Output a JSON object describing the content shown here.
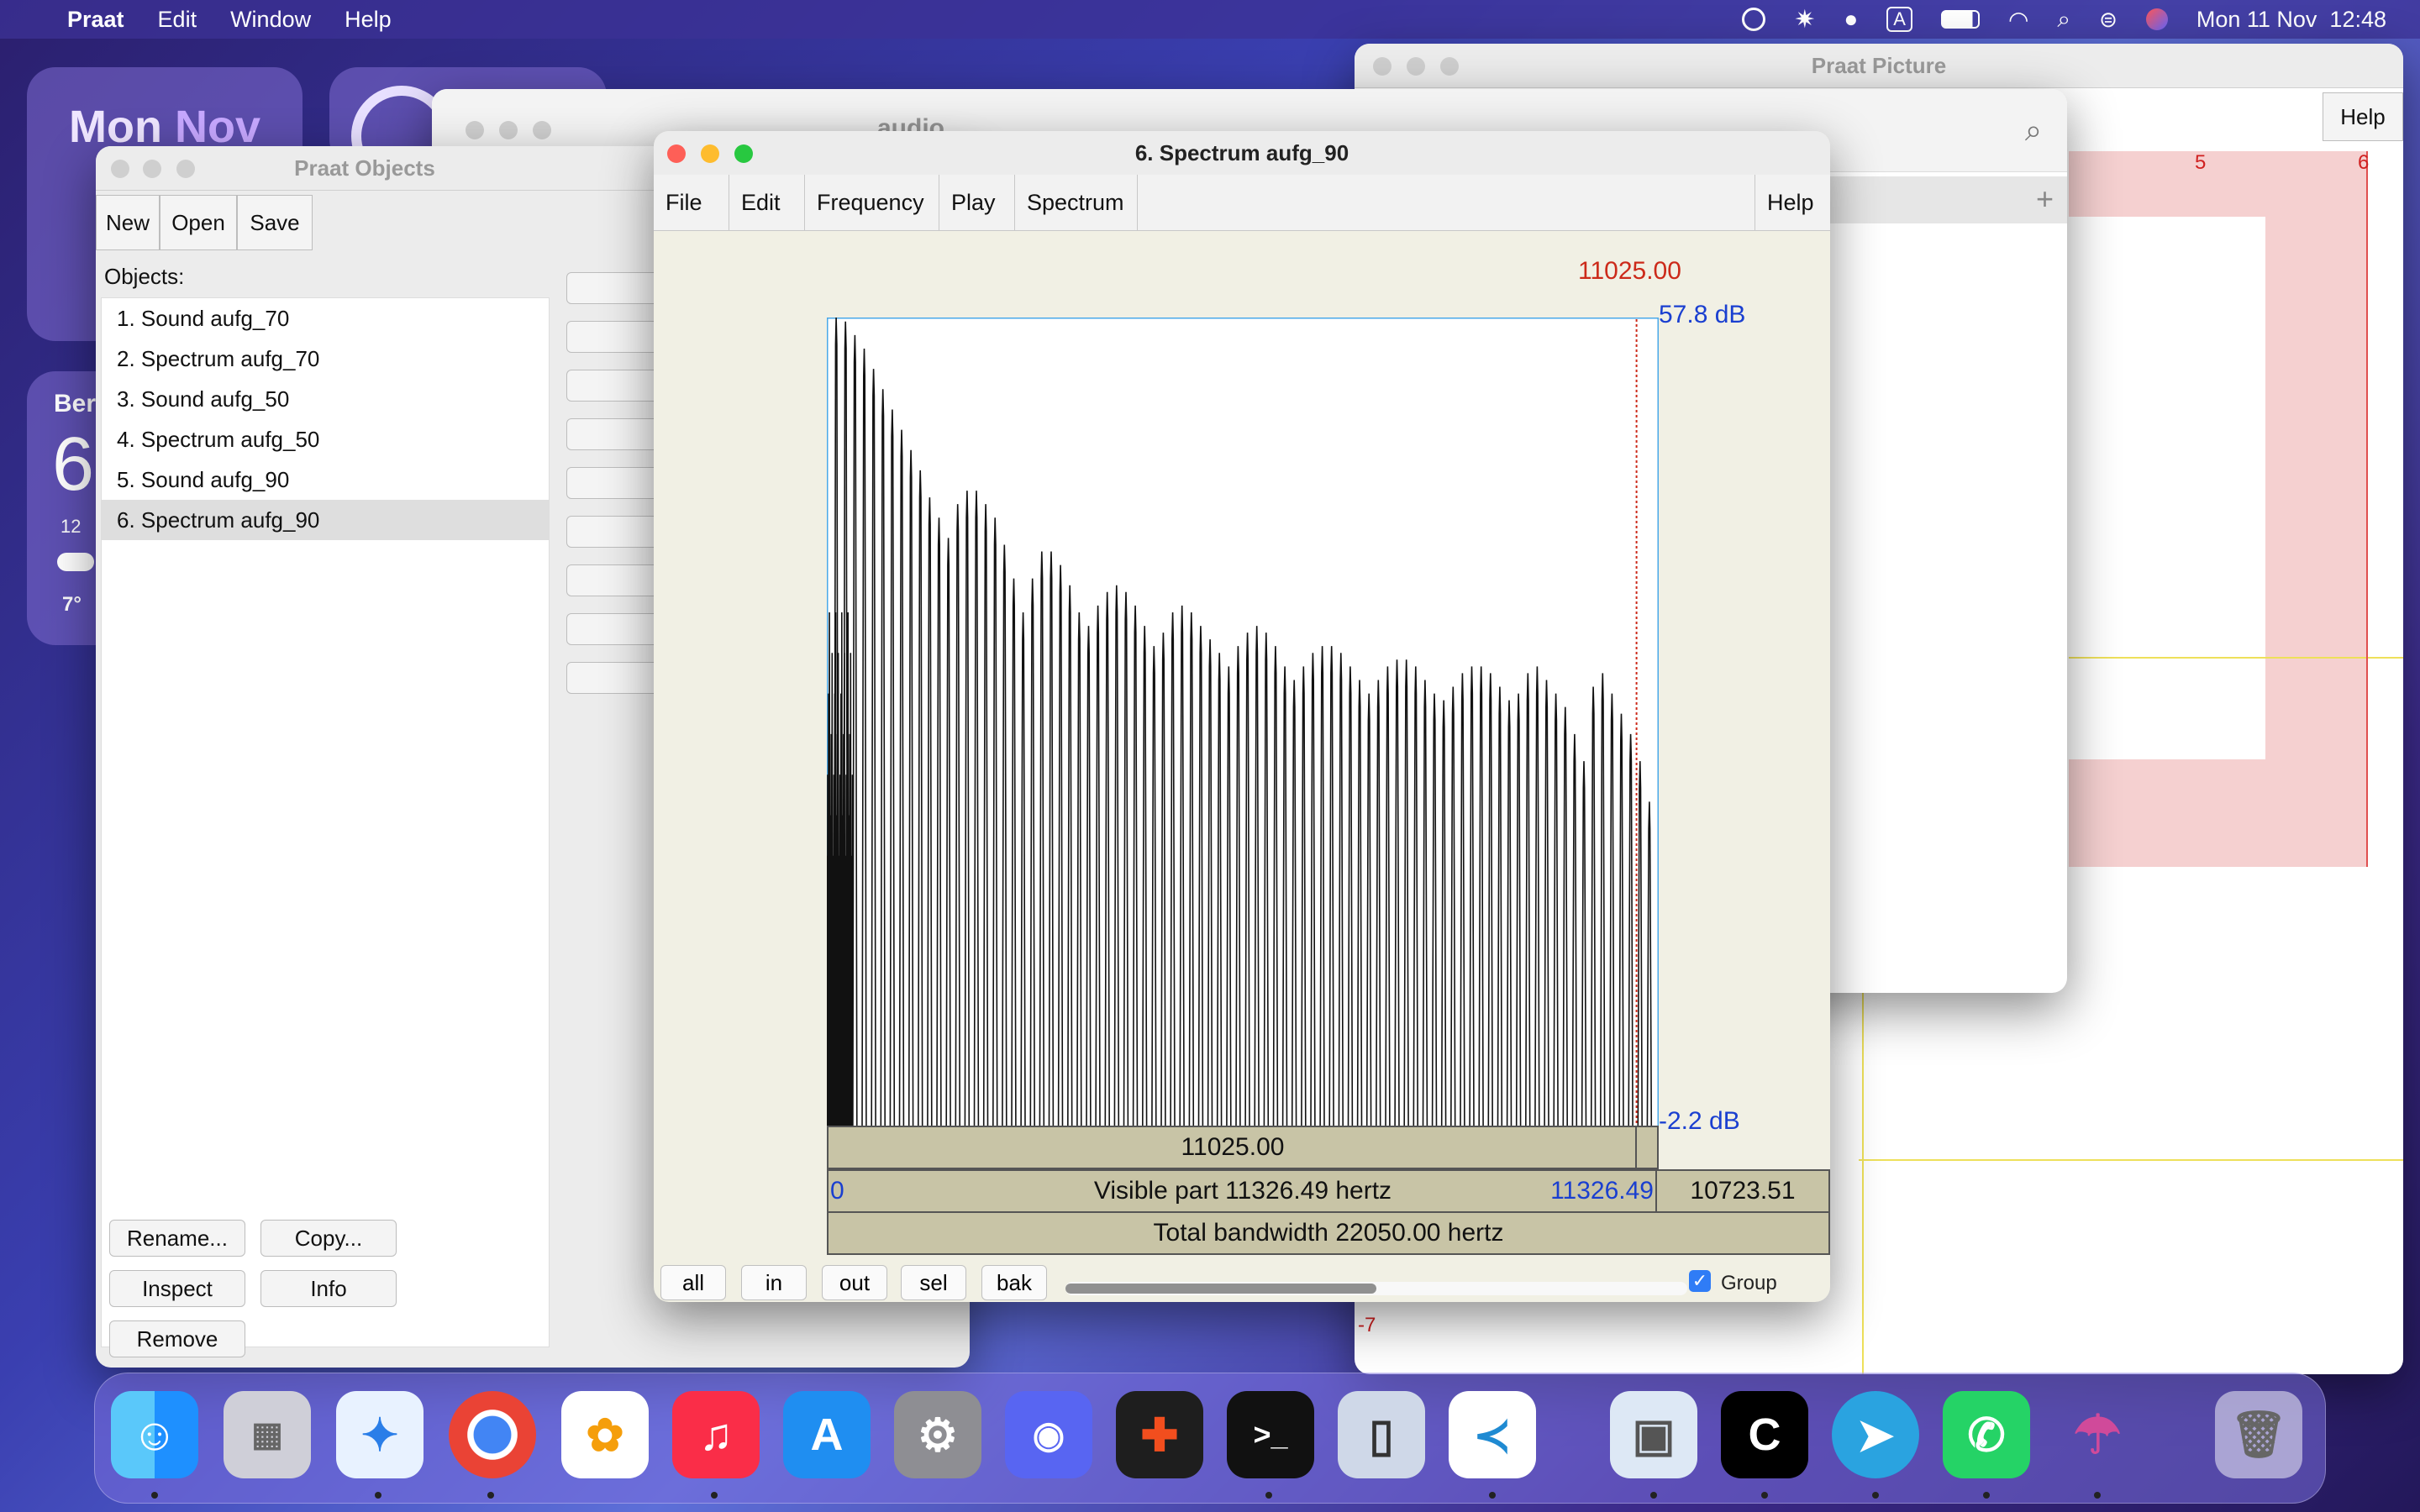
{
  "menubar": {
    "app": "Praat",
    "items": [
      "Edit",
      "Window",
      "Help"
    ],
    "clock": "Mon 11 Nov  12:48"
  },
  "widgets": {
    "calendar_day": "Mon",
    "calendar_month": "Nov",
    "weather_city": "Ber",
    "weather_temp": "6",
    "weather_hour": "12",
    "weather_low": "7°"
  },
  "picture_window": {
    "title": "Praat Picture",
    "help": "Help",
    "ruler_marks": [
      "5",
      "6"
    ],
    "bottom_value": "-7"
  },
  "finder_window": {
    "title": "audio"
  },
  "objects_window": {
    "title": "Praat Objects",
    "toolbar": [
      "New",
      "Open",
      "Save"
    ],
    "objects_label": "Objects:",
    "objects": [
      "1. Sound aufg_70",
      "2. Spectrum aufg_70",
      "3. Sound aufg_50",
      "4. Spectrum aufg_50",
      "5. Sound aufg_90",
      "6. Spectrum aufg_90"
    ],
    "selected_index": 5,
    "buttons": {
      "rename": "Rename...",
      "copy": "Copy...",
      "inspect": "Inspect",
      "info": "Info",
      "remove": "Remove"
    }
  },
  "spectrum_window": {
    "title": "6. Spectrum aufg_90",
    "menus": [
      "File",
      "Edit",
      "Frequency",
      "Play",
      "Spectrum"
    ],
    "help": "Help",
    "cursor_label": "11025.00",
    "top_db": "57.8 dB",
    "bottom_db": "-2.2 dB",
    "cursor_bar": "11025.00",
    "visible_left": "0",
    "visible_text": "Visible part 11326.49 hertz",
    "visible_right": "11326.49",
    "right_value": "10723.51",
    "total_text": "Total bandwidth 22050.00 hertz",
    "zoom_buttons": [
      "all",
      "in",
      "out",
      "sel",
      "bak"
    ],
    "group_label": "Group",
    "group_checked": true
  },
  "chart_data": {
    "type": "line",
    "x_unit": "Hz",
    "y_unit": "dB",
    "xlim": [
      0,
      11326.49
    ],
    "ylim": [
      -2.2,
      57.8
    ],
    "cursor_x": 11025.0,
    "harmonic_peaks_db": [
      57.8,
      57.5,
      56.5,
      55.5,
      54,
      52.5,
      51,
      49.5,
      48,
      46.5,
      44.5,
      43,
      41.5,
      44,
      45,
      45,
      44,
      43,
      41,
      38.5,
      36,
      38.5,
      40.5,
      40.5,
      39.5,
      38,
      36,
      35,
      36.5,
      37.5,
      38,
      37.5,
      36.5,
      35,
      33.5,
      34.5,
      36,
      36.5,
      36,
      35,
      34,
      33,
      32,
      33.5,
      34.5,
      35,
      34.5,
      33.5,
      32,
      31,
      32,
      33,
      33.5,
      33.5,
      33,
      32,
      31,
      30,
      31,
      32,
      32.5,
      32.5,
      32,
      31,
      30,
      29.5,
      30.5,
      31.5,
      32,
      32,
      31.5,
      30.5,
      29.5,
      30,
      31.5,
      32,
      31,
      30,
      29,
      27,
      25,
      30.5,
      31.5,
      30,
      28.5,
      27,
      25,
      22
    ]
  },
  "dock": {
    "apps": [
      "Finder",
      "Launchpad",
      "Safari",
      "Chrome",
      "Photos",
      "Music",
      "App Store",
      "System Settings",
      "Discord",
      "Figma",
      "Terminal",
      "iPhone Mirroring",
      "VS Code",
      "Preview",
      "Cursor",
      "Telegram",
      "WhatsApp",
      "Praat",
      "Trash"
    ]
  },
  "colors": {
    "spectrum_bg": "#f1f0e4",
    "plot_border": "#4aa8e8",
    "db_label": "#1a3fd0",
    "cursor": "#cc2a1a",
    "bar_fill": "#c8c4a6"
  }
}
